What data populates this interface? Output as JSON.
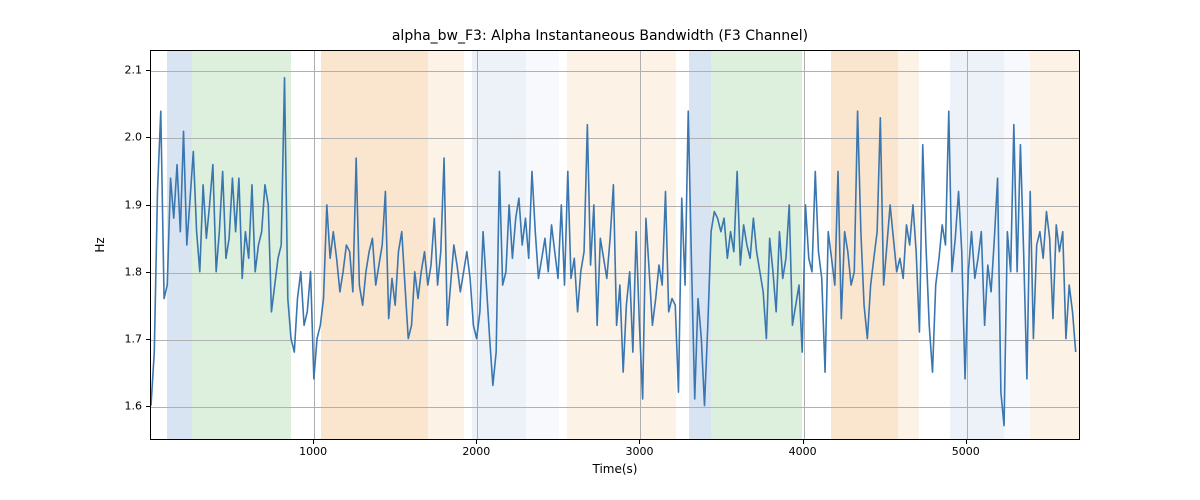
{
  "chart_data": {
    "type": "line",
    "title": "alpha_bw_F3: Alpha Instantaneous Bandwidth (F3 Channel)",
    "xlabel": "Time(s)",
    "ylabel": "Hz",
    "xlim": [
      0,
      5700
    ],
    "ylim": [
      1.55,
      2.13
    ],
    "xticks": [
      1000,
      2000,
      3000,
      4000,
      5000
    ],
    "yticks": [
      1.6,
      1.7,
      1.8,
      1.9,
      2.0,
      2.1
    ],
    "bands": [
      {
        "x0": 100,
        "x1": 250,
        "color": "#b9ceea"
      },
      {
        "x0": 250,
        "x1": 860,
        "color": "#c1e1c1"
      },
      {
        "x0": 1040,
        "x1": 1700,
        "color": "#f6cfa6"
      },
      {
        "x0": 1700,
        "x1": 1920,
        "color": "#fbe7d2"
      },
      {
        "x0": 1970,
        "x1": 2300,
        "color": "#dfe8f3"
      },
      {
        "x0": 2300,
        "x1": 2500,
        "color": "#f0f4fa"
      },
      {
        "x0": 2550,
        "x1": 3220,
        "color": "#fbe7d2"
      },
      {
        "x0": 3300,
        "x1": 3430,
        "color": "#b9ceea"
      },
      {
        "x0": 3430,
        "x1": 3990,
        "color": "#c1e1c1"
      },
      {
        "x0": 4170,
        "x1": 4580,
        "color": "#f6cfa6"
      },
      {
        "x0": 4580,
        "x1": 4710,
        "color": "#fbe7d2"
      },
      {
        "x0": 4900,
        "x1": 5230,
        "color": "#dfe8f3"
      },
      {
        "x0": 5230,
        "x1": 5390,
        "color": "#f0f4fa"
      },
      {
        "x0": 5390,
        "x1": 5700,
        "color": "#fbe7d2"
      }
    ],
    "series": [
      {
        "name": "alpha_bw_F3",
        "color": "#3a76af",
        "x": [
          0,
          20,
          40,
          60,
          80,
          100,
          120,
          140,
          160,
          180,
          200,
          220,
          240,
          260,
          280,
          300,
          320,
          340,
          360,
          380,
          400,
          420,
          440,
          460,
          480,
          500,
          520,
          540,
          560,
          580,
          600,
          620,
          640,
          660,
          680,
          700,
          720,
          740,
          760,
          780,
          800,
          820,
          840,
          860,
          880,
          900,
          920,
          940,
          960,
          980,
          1000,
          1020,
          1040,
          1060,
          1080,
          1100,
          1120,
          1140,
          1160,
          1180,
          1200,
          1220,
          1240,
          1260,
          1280,
          1300,
          1320,
          1340,
          1360,
          1380,
          1400,
          1420,
          1440,
          1460,
          1480,
          1500,
          1520,
          1540,
          1560,
          1580,
          1600,
          1620,
          1640,
          1660,
          1680,
          1700,
          1720,
          1740,
          1760,
          1780,
          1800,
          1820,
          1840,
          1860,
          1880,
          1900,
          1920,
          1940,
          1960,
          1980,
          2000,
          2020,
          2040,
          2060,
          2080,
          2100,
          2120,
          2140,
          2160,
          2180,
          2200,
          2220,
          2240,
          2260,
          2280,
          2300,
          2320,
          2340,
          2360,
          2380,
          2400,
          2420,
          2440,
          2460,
          2480,
          2500,
          2520,
          2540,
          2560,
          2580,
          2600,
          2620,
          2640,
          2660,
          2680,
          2700,
          2720,
          2740,
          2760,
          2780,
          2800,
          2820,
          2840,
          2860,
          2880,
          2900,
          2920,
          2940,
          2960,
          2980,
          3000,
          3020,
          3040,
          3060,
          3080,
          3100,
          3120,
          3140,
          3160,
          3180,
          3200,
          3220,
          3240,
          3260,
          3280,
          3300,
          3320,
          3340,
          3360,
          3380,
          3400,
          3420,
          3440,
          3460,
          3480,
          3500,
          3520,
          3540,
          3560,
          3580,
          3600,
          3620,
          3640,
          3660,
          3680,
          3700,
          3720,
          3740,
          3760,
          3780,
          3800,
          3820,
          3840,
          3860,
          3880,
          3900,
          3920,
          3940,
          3960,
          3980,
          4000,
          4020,
          4040,
          4060,
          4080,
          4100,
          4120,
          4140,
          4160,
          4180,
          4200,
          4220,
          4240,
          4260,
          4280,
          4300,
          4320,
          4340,
          4360,
          4380,
          4400,
          4420,
          4440,
          4460,
          4480,
          4500,
          4520,
          4540,
          4560,
          4580,
          4600,
          4620,
          4640,
          4660,
          4680,
          4700,
          4720,
          4740,
          4760,
          4780,
          4800,
          4820,
          4840,
          4860,
          4880,
          4900,
          4920,
          4940,
          4960,
          4980,
          5000,
          5020,
          5040,
          5060,
          5080,
          5100,
          5120,
          5140,
          5160,
          5180,
          5200,
          5220,
          5240,
          5260,
          5280,
          5300,
          5320,
          5340,
          5360,
          5380,
          5400,
          5420,
          5440,
          5460,
          5480,
          5500,
          5520,
          5540,
          5560,
          5580,
          5600,
          5620,
          5640,
          5660,
          5680,
          5700
        ],
        "y": [
          1.6,
          1.68,
          1.92,
          2.04,
          1.76,
          1.78,
          1.94,
          1.88,
          1.96,
          1.86,
          2.01,
          1.84,
          1.91,
          1.98,
          1.86,
          1.8,
          1.93,
          1.85,
          1.9,
          1.96,
          1.8,
          1.86,
          1.95,
          1.82,
          1.85,
          1.94,
          1.86,
          1.94,
          1.79,
          1.86,
          1.82,
          1.93,
          1.8,
          1.84,
          1.86,
          1.93,
          1.9,
          1.74,
          1.78,
          1.82,
          1.84,
          2.09,
          1.76,
          1.7,
          1.68,
          1.76,
          1.8,
          1.72,
          1.74,
          1.8,
          1.64,
          1.7,
          1.72,
          1.76,
          1.9,
          1.82,
          1.86,
          1.82,
          1.77,
          1.8,
          1.84,
          1.83,
          1.77,
          1.97,
          1.78,
          1.75,
          1.8,
          1.83,
          1.85,
          1.78,
          1.81,
          1.84,
          1.92,
          1.73,
          1.79,
          1.75,
          1.83,
          1.86,
          1.78,
          1.7,
          1.72,
          1.8,
          1.76,
          1.8,
          1.83,
          1.78,
          1.81,
          1.88,
          1.78,
          1.83,
          1.97,
          1.72,
          1.78,
          1.84,
          1.81,
          1.77,
          1.8,
          1.83,
          1.79,
          1.72,
          1.7,
          1.74,
          1.86,
          1.78,
          1.7,
          1.63,
          1.68,
          1.95,
          1.78,
          1.8,
          1.9,
          1.82,
          1.88,
          1.91,
          1.84,
          1.88,
          1.82,
          1.95,
          1.86,
          1.79,
          1.82,
          1.85,
          1.8,
          1.87,
          1.83,
          1.79,
          1.9,
          1.78,
          1.95,
          1.79,
          1.82,
          1.74,
          1.8,
          1.83,
          2.02,
          1.81,
          1.9,
          1.72,
          1.85,
          1.82,
          1.79,
          1.85,
          1.93,
          1.72,
          1.78,
          1.65,
          1.75,
          1.8,
          1.68,
          1.86,
          1.72,
          1.61,
          1.88,
          1.8,
          1.72,
          1.76,
          1.81,
          1.78,
          1.92,
          1.74,
          1.76,
          1.75,
          1.62,
          1.91,
          1.78,
          2.04,
          1.81,
          1.61,
          1.76,
          1.7,
          1.6,
          1.72,
          1.86,
          1.89,
          1.88,
          1.86,
          1.88,
          1.82,
          1.86,
          1.83,
          1.95,
          1.81,
          1.87,
          1.84,
          1.82,
          1.88,
          1.83,
          1.8,
          1.77,
          1.7,
          1.85,
          1.8,
          1.74,
          1.86,
          1.79,
          1.82,
          1.9,
          1.72,
          1.75,
          1.78,
          1.68,
          1.9,
          1.82,
          1.8,
          1.95,
          1.83,
          1.79,
          1.65,
          1.86,
          1.82,
          1.78,
          1.95,
          1.73,
          1.86,
          1.83,
          1.78,
          1.8,
          2.04,
          1.86,
          1.75,
          1.7,
          1.78,
          1.82,
          1.86,
          2.03,
          1.78,
          1.84,
          1.9,
          1.85,
          1.8,
          1.82,
          1.79,
          1.87,
          1.84,
          1.9,
          1.83,
          1.71,
          1.99,
          1.84,
          1.72,
          1.65,
          1.78,
          1.82,
          1.87,
          1.84,
          2.04,
          1.8,
          1.85,
          1.92,
          1.83,
          1.64,
          1.8,
          1.86,
          1.79,
          1.82,
          1.86,
          1.72,
          1.81,
          1.77,
          1.85,
          1.94,
          1.62,
          1.57,
          1.86,
          1.8,
          2.02,
          1.8,
          1.99,
          1.83,
          1.64,
          1.92,
          1.7,
          1.84,
          1.86,
          1.82,
          1.89,
          1.85,
          1.73,
          1.87,
          1.83,
          1.86,
          1.7,
          1.78,
          1.74,
          1.68
        ]
      }
    ]
  }
}
